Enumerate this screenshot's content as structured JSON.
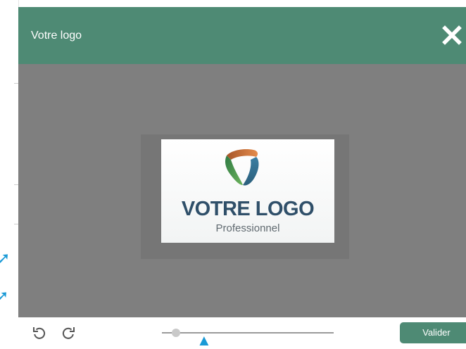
{
  "modal": {
    "title": "Votre logo",
    "close_icon": "close-icon",
    "accent_color": "#4e8a74"
  },
  "logo_preview": {
    "title": "VOTRE LOGO",
    "subtitle": "Professionnel"
  },
  "toolbar": {
    "rotate_left_icon": "rotate-left-icon",
    "rotate_right_icon": "rotate-right-icon",
    "zoom_level": 0.08,
    "validate_label": "Valider"
  },
  "annotations": {
    "arrow_icon": "arrow-pointer-icon",
    "arrow_color": "#1b9ad6"
  }
}
